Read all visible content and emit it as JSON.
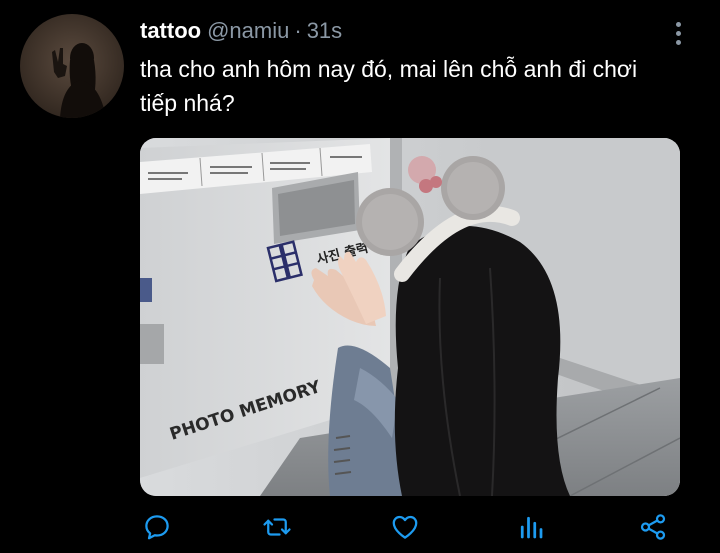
{
  "tweet": {
    "display_name": "tattoo",
    "handle": "@namiu",
    "separator": "·",
    "time": "31s",
    "text": "tha cho anh hôm nay đó, mai lên chỗ anh đi chơi tiếp nhá?"
  },
  "media": {
    "alt": "girl with mouse-ear headband in front of a PHOTO MEMORY booth",
    "booth_sign": "PHOTO MEMORY",
    "booth_korean": "사진 출력"
  },
  "actions": [
    {
      "name": "reply",
      "icon": "reply-icon"
    },
    {
      "name": "retweet",
      "icon": "retweet-icon"
    },
    {
      "name": "like",
      "icon": "heart-icon"
    },
    {
      "name": "analytics",
      "icon": "analytics-icon"
    },
    {
      "name": "share",
      "icon": "share-icon"
    }
  ],
  "colors": {
    "background": "#000000",
    "primary_text": "#ffffff",
    "secondary_text": "#8b98a5",
    "icon": "#1d9bf0"
  }
}
